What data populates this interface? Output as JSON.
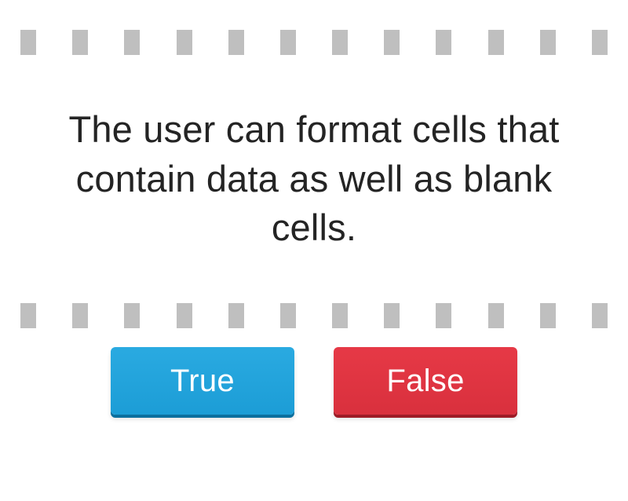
{
  "question": {
    "text": "The user can format cells that contain data as well as blank cells."
  },
  "buttons": {
    "true_label": "True",
    "false_label": "False"
  }
}
